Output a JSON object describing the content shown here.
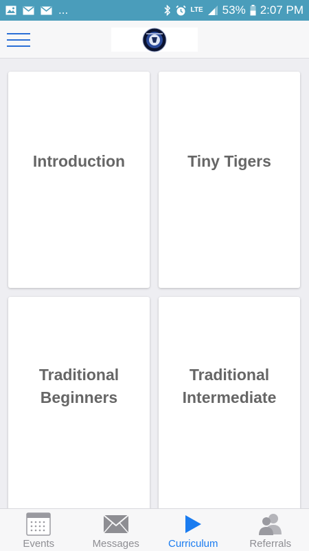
{
  "status_bar": {
    "battery": "53%",
    "time": "2:07 PM",
    "network": "LTE",
    "overflow": "...",
    "icons": [
      "image-icon",
      "mail-icon",
      "mail-icon",
      "bluetooth-icon",
      "alarm-icon",
      "signal-icon",
      "battery-icon"
    ]
  },
  "header": {
    "menu_icon": "hamburger-menu-icon",
    "logo": "school-logo"
  },
  "cards": [
    {
      "label": "Introduction"
    },
    {
      "label": "Tiny Tigers"
    },
    {
      "label": "Traditional\nBeginners"
    },
    {
      "label": "Traditional\nIntermediate"
    }
  ],
  "tabs": [
    {
      "label": "Events",
      "icon": "calendar-icon",
      "active": false
    },
    {
      "label": "Messages",
      "icon": "envelope-icon",
      "active": false
    },
    {
      "label": "Curriculum",
      "icon": "play-icon",
      "active": true
    },
    {
      "label": "Referrals",
      "icon": "people-icon",
      "active": false
    }
  ],
  "colors": {
    "status_bar": "#4a9dbb",
    "accent": "#1a7cf0",
    "card_text": "#666666",
    "tab_inactive": "#8e8e93"
  }
}
